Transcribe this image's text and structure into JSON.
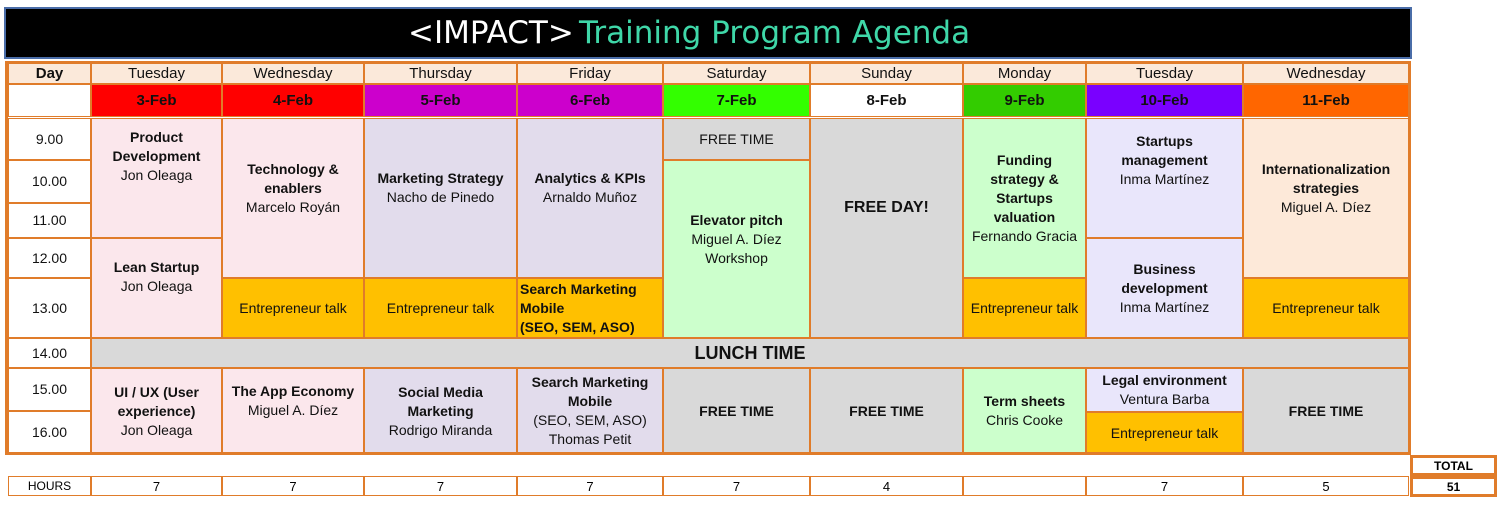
{
  "title": {
    "part1": "<IMPACT>",
    "part2": "Training Program Agenda"
  },
  "colors": {
    "accent_title": "#3fd7a8",
    "border": "#e07c2a"
  },
  "header": {
    "day_label": "Day",
    "days": [
      "Tuesday",
      "Wednesday",
      "Thursday",
      "Friday",
      "Saturday",
      "Sunday",
      "Monday",
      "Tuesday",
      "Wednesday"
    ],
    "dates": [
      "3-Feb",
      "4-Feb",
      "5-Feb",
      "6-Feb",
      "7-Feb",
      "8-Feb",
      "9-Feb",
      "10-Feb",
      "11-Feb"
    ],
    "date_colors": [
      "#ff0000",
      "#ff0000",
      "#cc00cc",
      "#cc00cc",
      "#33ff00",
      "#ffffff",
      "#33cc00",
      "#7a00ff",
      "#ff6600"
    ]
  },
  "times": [
    "9.00",
    "10.00",
    "11.00",
    "12.00",
    "13.00",
    "14.00",
    "15.00",
    "16.00"
  ],
  "sessions": {
    "tue3_a": {
      "title": "Product Development",
      "speaker": "Jon Oleaga"
    },
    "tue3_b": {
      "title": "Lean Startup",
      "speaker": "Jon Oleaga"
    },
    "tue3_c": {
      "title": "UI / UX (User experience)",
      "speaker": "Jon Oleaga"
    },
    "wed4_a": {
      "title": "Technology & enablers",
      "speaker": "Marcelo Royán"
    },
    "wed4_b": {
      "title": "Entrepreneur talk"
    },
    "wed4_c": {
      "title": "The App Economy",
      "speaker": "Miguel A. Díez"
    },
    "thu5_a": {
      "title": "Marketing Strategy",
      "speaker": "Nacho de Pinedo"
    },
    "thu5_b": {
      "title": "Entrepreneur talk"
    },
    "thu5_c": {
      "title": "Social Media Marketing",
      "speaker": "Rodrigo Miranda"
    },
    "fri6_a": {
      "title": "Analytics & KPIs",
      "speaker": "Arnaldo Muñoz"
    },
    "fri6_b": {
      "line1": "Search Marketing",
      "line2": "Mobile",
      "line3": "(SEO, SEM, ASO)"
    },
    "fri6_c": {
      "title": "Search Marketing Mobile",
      "subtitle": "(SEO, SEM, ASO)",
      "speaker": "Thomas Petit"
    },
    "sat7_a": {
      "title": "FREE TIME"
    },
    "sat7_b": {
      "title": "Elevator pitch",
      "speaker": "Miguel A. Díez",
      "note": "Workshop"
    },
    "sat7_c": {
      "title": "FREE TIME"
    },
    "sun8_a": {
      "title": "FREE DAY!"
    },
    "sun8_c": {
      "title": "FREE TIME"
    },
    "mon9_a": {
      "title": "Funding strategy & Startups valuation",
      "speaker": "Fernando Gracia"
    },
    "mon9_b": {
      "title": "Entrepreneur talk"
    },
    "mon9_c": {
      "title": "Term sheets",
      "speaker": "Chris Cooke"
    },
    "tue10_a": {
      "title": "Startups management",
      "speaker": "Inma Martínez"
    },
    "tue10_b": {
      "title": "Business development",
      "speaker": "Inma Martínez"
    },
    "tue10_c": {
      "title": "Legal environment",
      "speaker": "Ventura Barba"
    },
    "tue10_d": {
      "title": "Entrepreneur talk"
    },
    "wed11_a": {
      "title": "Internationalization strategies",
      "speaker": "Miguel A. Díez"
    },
    "wed11_b": {
      "title": "Entrepreneur talk"
    },
    "wed11_c": {
      "title": "FREE TIME"
    }
  },
  "lunch": "LUNCH TIME",
  "footer": {
    "hours_label": "HOURS",
    "hours": [
      "7",
      "7",
      "7",
      "7",
      "7",
      "4",
      "",
      "7",
      "5"
    ],
    "total_label": "TOTAL",
    "total_value": "51"
  }
}
